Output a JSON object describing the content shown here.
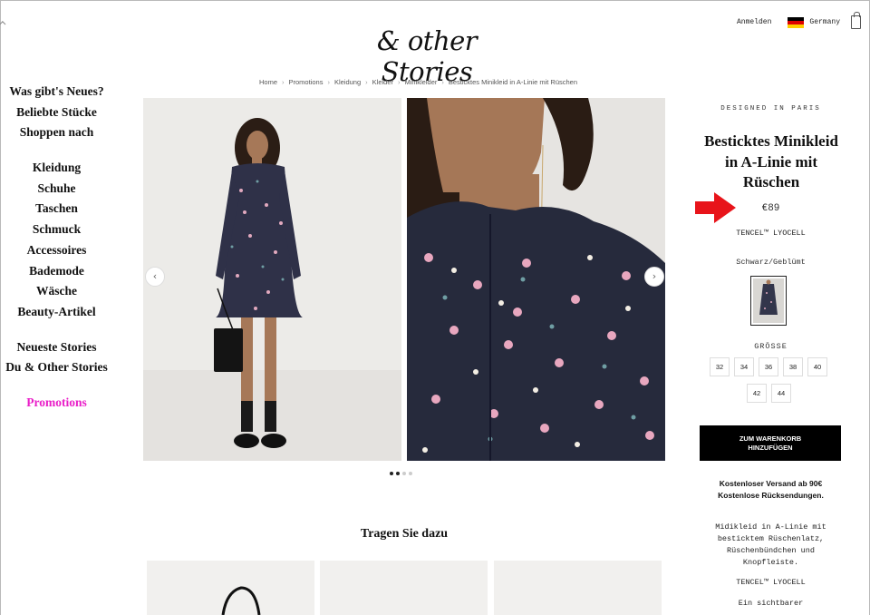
{
  "header": {
    "logo_text": "& other Stories",
    "login_label": "Anmelden",
    "country_label": "Germany",
    "flag_colors": [
      "#000000",
      "#dd0000",
      "#ffce00"
    ]
  },
  "breadcrumb": [
    "Home",
    "Promotions",
    "Kleidung",
    "Kleider",
    "Minikleider",
    "Besticktes Minikleid in A-Linie mit Rüschen"
  ],
  "nav": {
    "group1": [
      "Was gibt's Neues?",
      "Beliebte Stücke",
      "Shoppen nach"
    ],
    "group2": [
      "Kleidung",
      "Schuhe",
      "Taschen",
      "Schmuck",
      "Accessoires",
      "Bademode",
      "Wäsche",
      "Beauty-Artikel"
    ],
    "group3": [
      "Neueste Stories",
      "Du & Other Stories"
    ],
    "promo": "Promotions",
    "promo_color": "#e91ec8"
  },
  "gallery": {
    "prev_icon": "chevron-left-icon",
    "next_icon": "chevron-right-icon",
    "prev_glyph": "‹",
    "next_glyph": "›"
  },
  "wear_with_title": "Tragen Sie dazu",
  "product": {
    "designed_in": "DESIGNED IN PARIS",
    "title": "Besticktes Minikleid in A-Linie mit Rüschen",
    "price": "€89",
    "material": "TENCEL™ LYOCELL",
    "color_name": "Schwarz/Geblümt",
    "size_label": "GRÖSSE",
    "sizes": [
      "32",
      "34",
      "36",
      "38",
      "40",
      "42",
      "44"
    ],
    "cart_button_line1": "ZUM WARENKORB",
    "cart_button_line2": "HINZUFÜGEN",
    "shipping_line1": "Kostenloser Versand ab 90€",
    "shipping_line2": "Kostenlose Rücksendungen.",
    "description_lines": [
      "Midikleid in A-Linie mit",
      "besticktem Rüschenlatz,",
      "Rüschenbündchen und",
      "Knopfleiste."
    ],
    "material2": "TENCEL™ LYOCELL",
    "description2_line1": "Ein sichtbarer"
  },
  "annotation": {
    "arrow_color": "#e8141a"
  }
}
